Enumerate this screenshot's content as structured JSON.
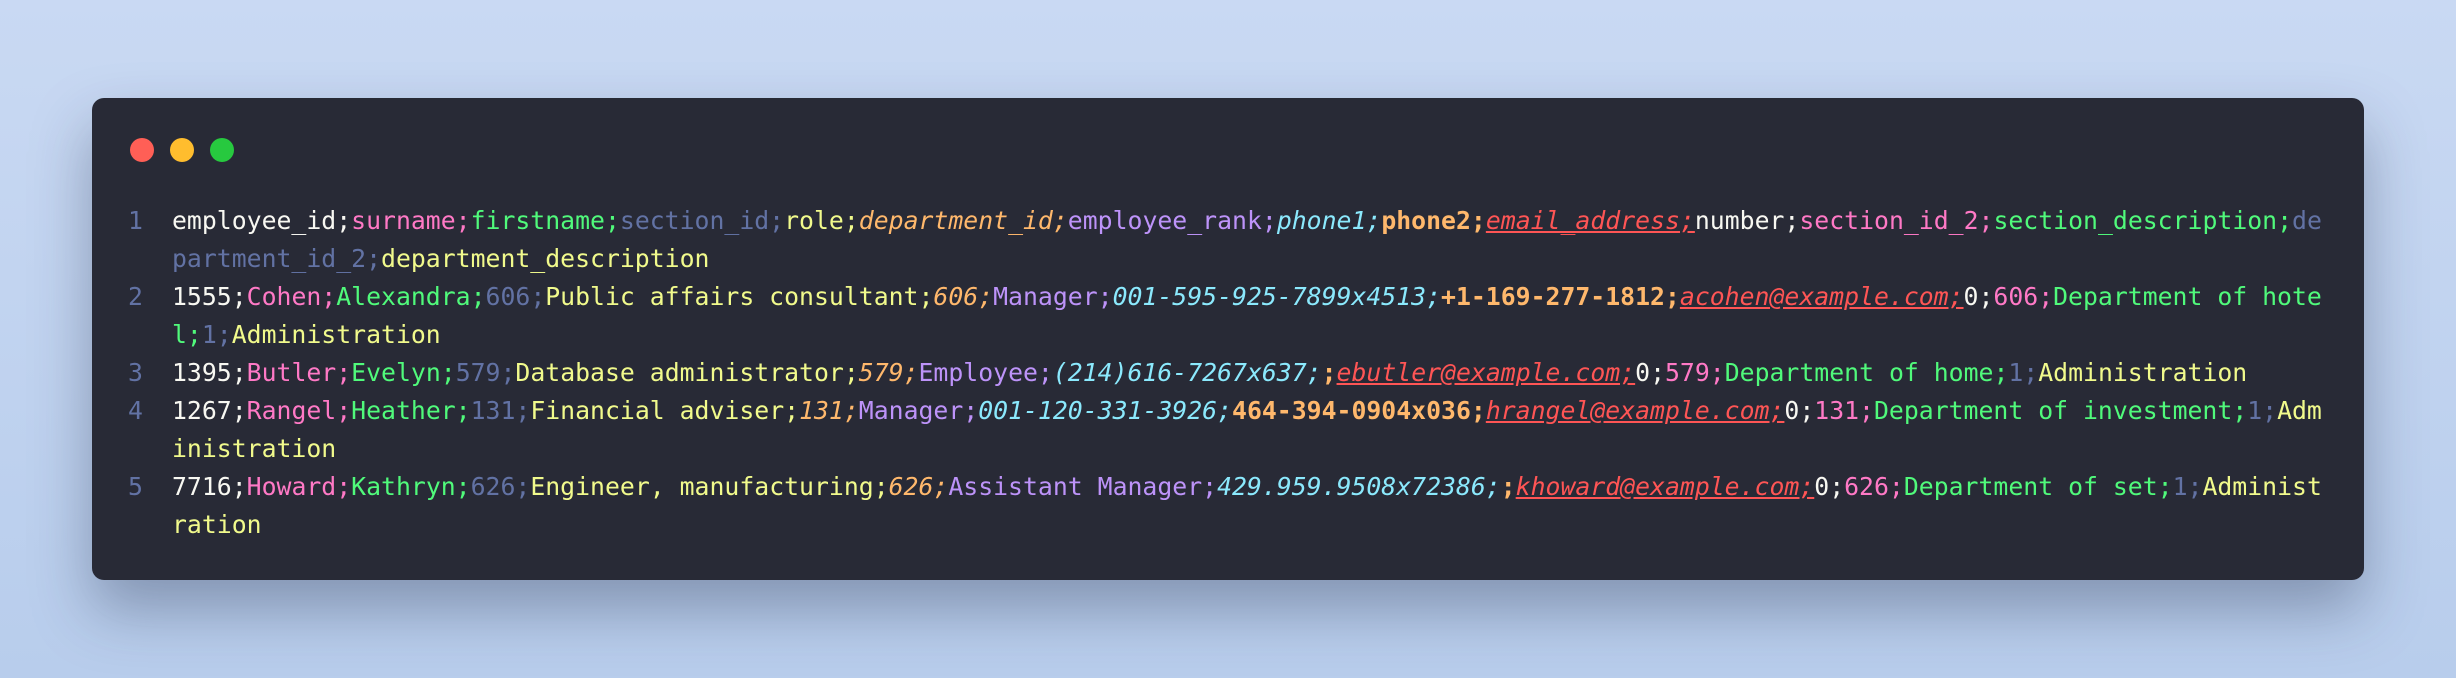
{
  "window": {
    "controls": [
      {
        "name": "close",
        "color": "#ff5f56"
      },
      {
        "name": "minimize",
        "color": "#ffbd2e"
      },
      {
        "name": "maximize",
        "color": "#27c93f"
      }
    ]
  },
  "lines": [
    {
      "number": "1",
      "cells": [
        "employee_id;",
        "surname;",
        "firstname;",
        "section_id;",
        "role;",
        "department_id;",
        "employee_rank;",
        "phone1;",
        "phone2;",
        "email_address;",
        "number;",
        "section_id_2;",
        "section_description;",
        "department_id_2;",
        "department_description"
      ]
    },
    {
      "number": "2",
      "cells": [
        "1555;",
        "Cohen;",
        "Alexandra;",
        "606;",
        "Public affairs consultant;",
        "606;",
        "Manager;",
        "001-595-925-7899x4513;",
        "+1-169-277-1812;",
        "acohen@example.com;",
        "0;",
        "606;",
        "Department of hotel;",
        "1;",
        "Administration"
      ]
    },
    {
      "number": "3",
      "cells": [
        "1395;",
        "Butler;",
        "Evelyn;",
        "579;",
        "Database administrator;",
        "579;",
        "Employee;",
        "(214)616-7267x637;",
        ";",
        "ebutler@example.com;",
        "0;",
        "579;",
        "Department of home;",
        "1;",
        "Administration"
      ]
    },
    {
      "number": "4",
      "cells": [
        "1267;",
        "Rangel;",
        "Heather;",
        "131;",
        "Financial adviser;",
        "131;",
        "Manager;",
        "001-120-331-3926;",
        "464-394-0904x036;",
        "hrangel@example.com;",
        "0;",
        "131;",
        "Department of investment;",
        "1;",
        "Administration"
      ]
    },
    {
      "number": "5",
      "cells": [
        "7716;",
        "Howard;",
        "Kathryn;",
        "626;",
        "Engineer, manufacturing;",
        "626;",
        "Assistant Manager;",
        "429.959.9508x72386;",
        ";",
        "khoward@example.com;",
        "0;",
        "626;",
        "Department of set;",
        "1;",
        "Administration"
      ]
    }
  ]
}
